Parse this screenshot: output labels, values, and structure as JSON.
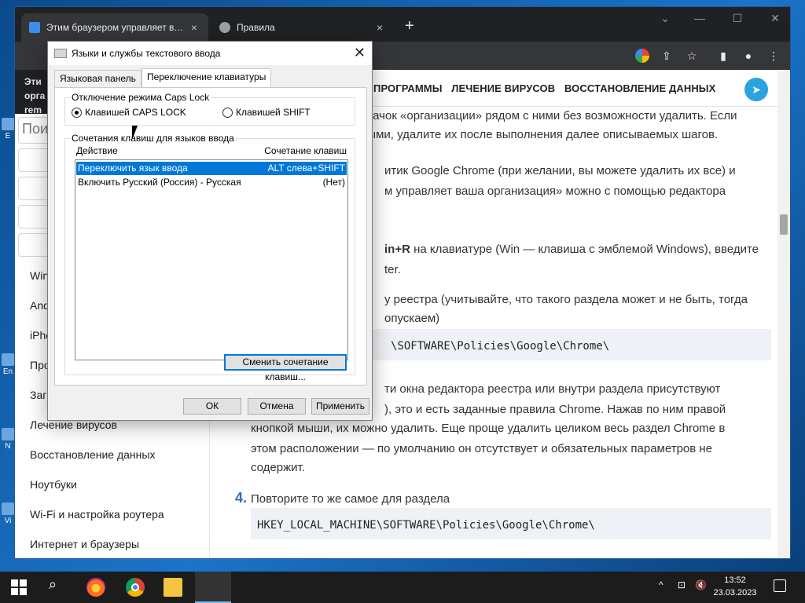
{
  "browser": {
    "tabs": [
      {
        "label": "Этим браузером управляет ваш...",
        "close": "×"
      },
      {
        "label": "Правила",
        "close": "×"
      }
    ],
    "new_tab": "+",
    "window_controls": {
      "minimize": "—",
      "maximize": "☐",
      "close": "✕"
    },
    "managed_banner": [
      "Эти",
      "орга",
      "rem"
    ]
  },
  "sidebar": {
    "search_placeholder": "Поис",
    "items": [
      "Win",
      "And",
      "iPho",
      "Про",
      "Загр",
      "Лечение вирусов",
      "Восстановление данных",
      "Ноутбуки",
      "Wi-Fi и настройка роутера",
      "Интернет и браузеры"
    ]
  },
  "nav": {
    "items": [
      "ПРОГРАММЫ",
      "ЛЕЧЕНИЕ ВИРУСОВ",
      "ВОССТАНОВЛЕНИЕ ДАННЫХ"
    ]
  },
  "article": {
    "p1": "значок «организации» рядом с ними без возможности удалить. Если",
    "p2": "ными, удалите их после выполнения далее описываемых шагов.",
    "p3": "итик Google Chrome (при желании, вы можете удалить их все) и",
    "p4": "м управляет ваша организация» можно с помощью редактора",
    "p5_bold": "in+R",
    "p5": " на клавиатуре (Win — клавиша с эмблемой Windows), введите",
    "p6": "ter.",
    "p7": "у реестра (учитывайте, что такого раздела может и не быть, тогда",
    "p8": "опускаем)",
    "code1": "\\SOFTWARE\\Policies\\Google\\Chrome\\",
    "p9": "ти окна редактора реестра или внутри раздела присутствуют",
    "p10": "), это и есть заданные правила Chrome. Нажав по ним правой",
    "p11": "кнопкой мыши, их можно удалить. Еще проще удалить целиком весь раздел Chrome в",
    "p12": "этом расположении — по умолчанию он отсутствует и обязательных параметров не",
    "p13": "содержит.",
    "step4_num": "4.",
    "step4": "Повторите то же самое для раздела",
    "code2": "HKEY_LOCAL_MACHINE\\SOFTWARE\\Policies\\Google\\Chrome\\"
  },
  "dialog": {
    "title": "Языки и службы текстового ввода",
    "tabs": [
      "Языковая панель",
      "Переключение клавиатуры"
    ],
    "caps_group": "Отключение режима Caps Lock",
    "caps_options": [
      "Клавишей CAPS LOCK",
      "Клавишей SHIFT"
    ],
    "hotkeys_group": "Сочетания клавиш для языков ввода",
    "col_action": "Действие",
    "col_keys": "Сочетание клавиш",
    "rows": [
      {
        "action": "Переключить язык ввода",
        "keys": "ALT слева+SHIFT"
      },
      {
        "action": "Включить Русский (Россия) - Русская",
        "keys": "(Нет)"
      }
    ],
    "change_button": "Сменить сочетание клавиш...",
    "ok": "ОК",
    "cancel": "Отмена",
    "apply": "Применить"
  },
  "taskbar": {
    "time": "13:52",
    "date": "23.03.2023",
    "tray": [
      "^",
      "⊡",
      "🔇"
    ]
  },
  "desktop": {
    "icon_labels": [
      "E",
      "En",
      "N",
      "Vi"
    ]
  }
}
